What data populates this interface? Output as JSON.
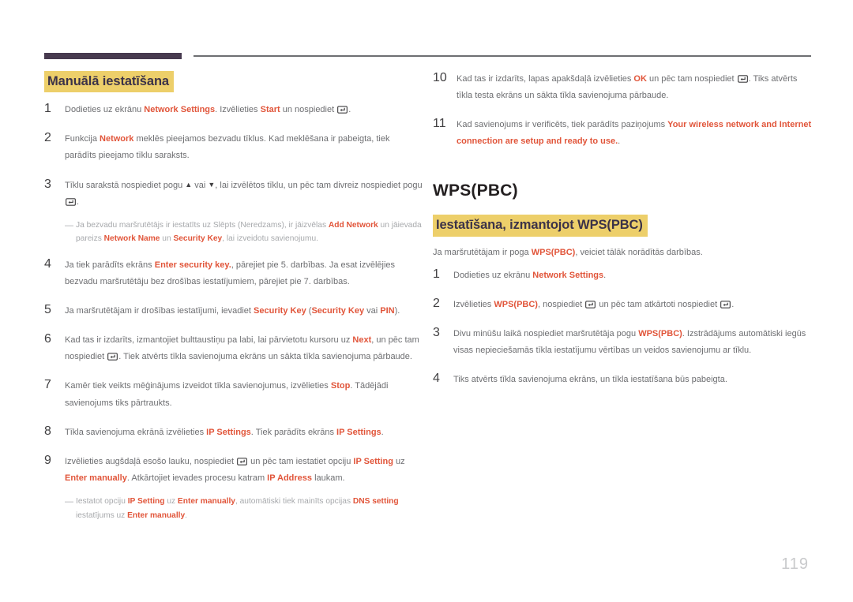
{
  "page": {
    "number": "119",
    "accent_purple": "#473a4f",
    "accent_gold": "#edcf6a",
    "accent_red": "#e1553a",
    "rule_gray": "#6e6f72",
    "body_gray": "#6d6e71"
  },
  "left_column": {
    "heading": "Manuālā iestatīšana",
    "steps": [
      {
        "num": "1",
        "parts": [
          {
            "t": "text",
            "v": "Dodieties uz ekrānu "
          },
          {
            "t": "red",
            "v": "Network Settings"
          },
          {
            "t": "text",
            "v": ". Izvēlieties "
          },
          {
            "t": "red",
            "v": "Start"
          },
          {
            "t": "text",
            "v": " un nospiediet "
          },
          {
            "t": "enter-key"
          },
          {
            "t": "text",
            "v": "."
          }
        ]
      },
      {
        "num": "2",
        "parts": [
          {
            "t": "text",
            "v": "Funkcija "
          },
          {
            "t": "red",
            "v": "Network"
          },
          {
            "t": "text",
            "v": " meklēs pieejamos bezvadu tīklus. Kad meklēšana ir pabeigta, tiek parādīts pieejamo tīklu saraksts."
          }
        ]
      },
      {
        "num": "3",
        "parts": [
          {
            "t": "text",
            "v": "Tīklu sarakstā nospiediet pogu "
          },
          {
            "t": "tri-up"
          },
          {
            "t": "text",
            "v": " vai "
          },
          {
            "t": "tri-down"
          },
          {
            "t": "text",
            "v": ", lai izvēlētos tīklu, un pēc tam divreiz nospiediet pogu "
          },
          {
            "t": "enter-key"
          },
          {
            "t": "text",
            "v": "."
          }
        ]
      },
      {
        "num": "4",
        "parts": [
          {
            "t": "text",
            "v": "Ja tiek parādīts ekrāns "
          },
          {
            "t": "red",
            "v": "Enter security key."
          },
          {
            "t": "text",
            "v": ", pārejiet pie 5. darbības. Ja esat izvēlējies bezvadu maršrutētāju bez drošības iestatījumiem, pārejiet pie 7. darbības."
          }
        ]
      },
      {
        "num": "5",
        "parts": [
          {
            "t": "text",
            "v": "Ja maršrutētājam ir drošības iestatījumi, ievadiet "
          },
          {
            "t": "red",
            "v": "Security Key"
          },
          {
            "t": "text",
            "v": " ("
          },
          {
            "t": "red",
            "v": "Security Key"
          },
          {
            "t": "text",
            "v": " vai "
          },
          {
            "t": "red",
            "v": "PIN"
          },
          {
            "t": "text",
            "v": ")."
          }
        ]
      },
      {
        "num": "6",
        "parts": [
          {
            "t": "text",
            "v": "Kad tas ir izdarīts, izmantojiet bulttaustiņu pa labi, lai pārvietotu kursoru uz "
          },
          {
            "t": "red",
            "v": "Next"
          },
          {
            "t": "text",
            "v": ", un pēc tam nospiediet "
          },
          {
            "t": "enter-key"
          },
          {
            "t": "text",
            "v": ". Tiek atvērts tīkla savienojuma ekrāns un sākta tīkla savienojuma pārbaude."
          }
        ]
      },
      {
        "num": "7",
        "parts": [
          {
            "t": "text",
            "v": "Kamēr tiek veikts mēģinājums izveidot tīkla savienojumus, izvēlieties "
          },
          {
            "t": "red",
            "v": "Stop"
          },
          {
            "t": "text",
            "v": ". Tādējādi savienojums tiks pārtraukts."
          }
        ]
      },
      {
        "num": "8",
        "parts": [
          {
            "t": "text",
            "v": "Tīkla savienojuma ekrānā izvēlieties "
          },
          {
            "t": "red",
            "v": "IP Settings"
          },
          {
            "t": "text",
            "v": ". Tiek parādīts ekrāns "
          },
          {
            "t": "red",
            "v": "IP Settings"
          },
          {
            "t": "text",
            "v": "."
          }
        ]
      },
      {
        "num": "9",
        "parts": [
          {
            "t": "text",
            "v": "Izvēlieties augšdaļā esošo lauku, nospiediet "
          },
          {
            "t": "enter-key"
          },
          {
            "t": "text",
            "v": " un pēc tam iestatiet opciju "
          },
          {
            "t": "red",
            "v": "IP Setting"
          },
          {
            "t": "text",
            "v": " uz "
          },
          {
            "t": "red",
            "v": "Enter manually"
          },
          {
            "t": "text",
            "v": ". Atkārtojiet ievades procesu katram "
          },
          {
            "t": "red",
            "v": "IP Address"
          },
          {
            "t": "text",
            "v": " laukam."
          }
        ]
      }
    ],
    "note_after_step3": [
      {
        "t": "text",
        "v": "Ja bezvadu maršrutētājs ir iestatīts uz Slēpts (Neredzams), ir jāizvēlas "
      },
      {
        "t": "red",
        "v": "Add Network"
      },
      {
        "t": "text",
        "v": " un jāievada pareizs "
      },
      {
        "t": "red",
        "v": "Network Name"
      },
      {
        "t": "text",
        "v": " un "
      },
      {
        "t": "red",
        "v": "Security Key"
      },
      {
        "t": "text",
        "v": ", lai izveidotu savienojumu."
      }
    ],
    "note_after_step9": [
      {
        "t": "text",
        "v": "Iestatot opciju "
      },
      {
        "t": "red",
        "v": "IP Setting"
      },
      {
        "t": "text",
        "v": " uz "
      },
      {
        "t": "red",
        "v": "Enter manually"
      },
      {
        "t": "text",
        "v": ", automātiski tiek mainīts opcijas "
      },
      {
        "t": "red",
        "v": "DNS setting"
      },
      {
        "t": "text",
        "v": " iestatījums uz "
      },
      {
        "t": "red",
        "v": "Enter manually"
      },
      {
        "t": "text",
        "v": "."
      }
    ]
  },
  "right_column": {
    "continued_steps": [
      {
        "num": "10",
        "parts": [
          {
            "t": "text",
            "v": "Kad tas ir izdarīts, lapas apakšdaļā izvēlieties "
          },
          {
            "t": "red",
            "v": "OK"
          },
          {
            "t": "text",
            "v": " un pēc tam nospiediet "
          },
          {
            "t": "enter-key"
          },
          {
            "t": "text",
            "v": ". Tiks atvērts tīkla testa ekrāns un sākta tīkla savienojuma pārbaude."
          }
        ]
      },
      {
        "num": "11",
        "parts": [
          {
            "t": "text",
            "v": "Kad savienojums ir verificēts, tiek parādīts paziņojums "
          },
          {
            "t": "red",
            "v": "Your wireless network and Internet connection are setup and ready to use."
          },
          {
            "t": "text",
            "v": "."
          }
        ]
      }
    ],
    "main_heading": "WPS(PBC)",
    "sub_heading": "Iestatīšana, izmantojot WPS(PBC)",
    "intro": [
      {
        "t": "text",
        "v": "Ja maršrutētājam ir poga "
      },
      {
        "t": "red",
        "v": "WPS(PBC)"
      },
      {
        "t": "text",
        "v": ", veiciet tālāk norādītās darbības."
      }
    ],
    "steps": [
      {
        "num": "1",
        "parts": [
          {
            "t": "text",
            "v": "Dodieties uz ekrānu "
          },
          {
            "t": "red",
            "v": "Network Settings"
          },
          {
            "t": "text",
            "v": "."
          }
        ]
      },
      {
        "num": "2",
        "parts": [
          {
            "t": "text",
            "v": "Izvēlieties "
          },
          {
            "t": "red",
            "v": "WPS(PBC)"
          },
          {
            "t": "text",
            "v": ", nospiediet "
          },
          {
            "t": "enter-key"
          },
          {
            "t": "text",
            "v": " un pēc tam atkārtoti nospiediet "
          },
          {
            "t": "enter-key"
          },
          {
            "t": "text",
            "v": "."
          }
        ]
      },
      {
        "num": "3",
        "parts": [
          {
            "t": "text",
            "v": "Divu minūšu laikā nospiediet maršrutētāja pogu "
          },
          {
            "t": "red",
            "v": "WPS(PBC)"
          },
          {
            "t": "text",
            "v": ". Izstrādājums automātiski iegūs visas nepieciešamās tīkla iestatījumu vērtības un veidos savienojumu ar tīklu."
          }
        ]
      },
      {
        "num": "4",
        "parts": [
          {
            "t": "text",
            "v": "Tiks atvērts tīkla savienojuma ekrāns, un tīkla iestatīšana būs pabeigta."
          }
        ]
      }
    ]
  },
  "icons": {
    "enter_key": "enter-key-icon",
    "triangle_up": "triangle-up-icon",
    "triangle_down": "triangle-down-icon"
  }
}
